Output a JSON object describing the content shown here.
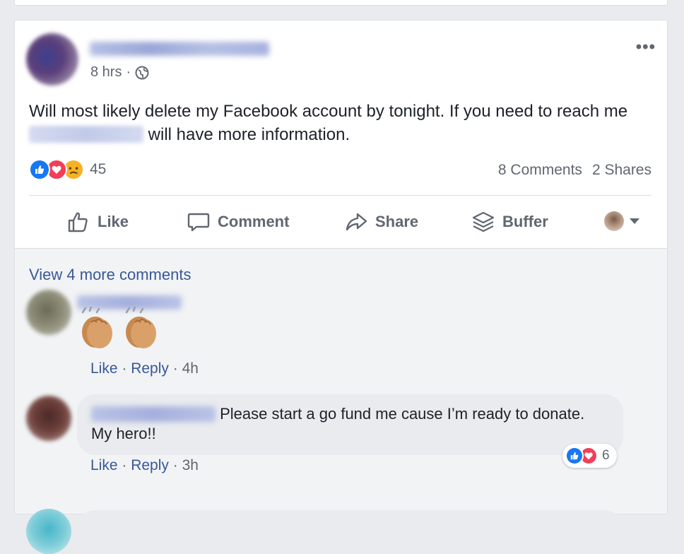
{
  "post": {
    "time": "8 hrs",
    "separator": "·",
    "more": "•••",
    "text_part1": "Will most likely delete my Facebook account by tonight. If you need to reach me",
    "text_part2": "will have more information.",
    "reaction_count": "45",
    "comments": "8 Comments",
    "shares": "2 Shares",
    "reactions": [
      "like-icon",
      "love-icon",
      "sad-icon"
    ]
  },
  "actions": {
    "like": "Like",
    "comment": "Comment",
    "share": "Share",
    "buffer": "Buffer"
  },
  "comments": {
    "view_more": "View 4 more comments",
    "items": [
      {
        "content": "clapping-hands-emoji x2",
        "like": "Like",
        "reply": "Reply",
        "time": "4h"
      },
      {
        "text": "Please start a go fund me cause I’m ready to donate. My hero!!",
        "reaction_count": "6",
        "like": "Like",
        "reply": "Reply",
        "time": "3h"
      }
    ]
  },
  "colors": {
    "link": "#385898",
    "like_blue": "#1877f2",
    "love_red": "#f33e58",
    "sad_yellow": "#f7b125",
    "muted_text": "#606770"
  }
}
